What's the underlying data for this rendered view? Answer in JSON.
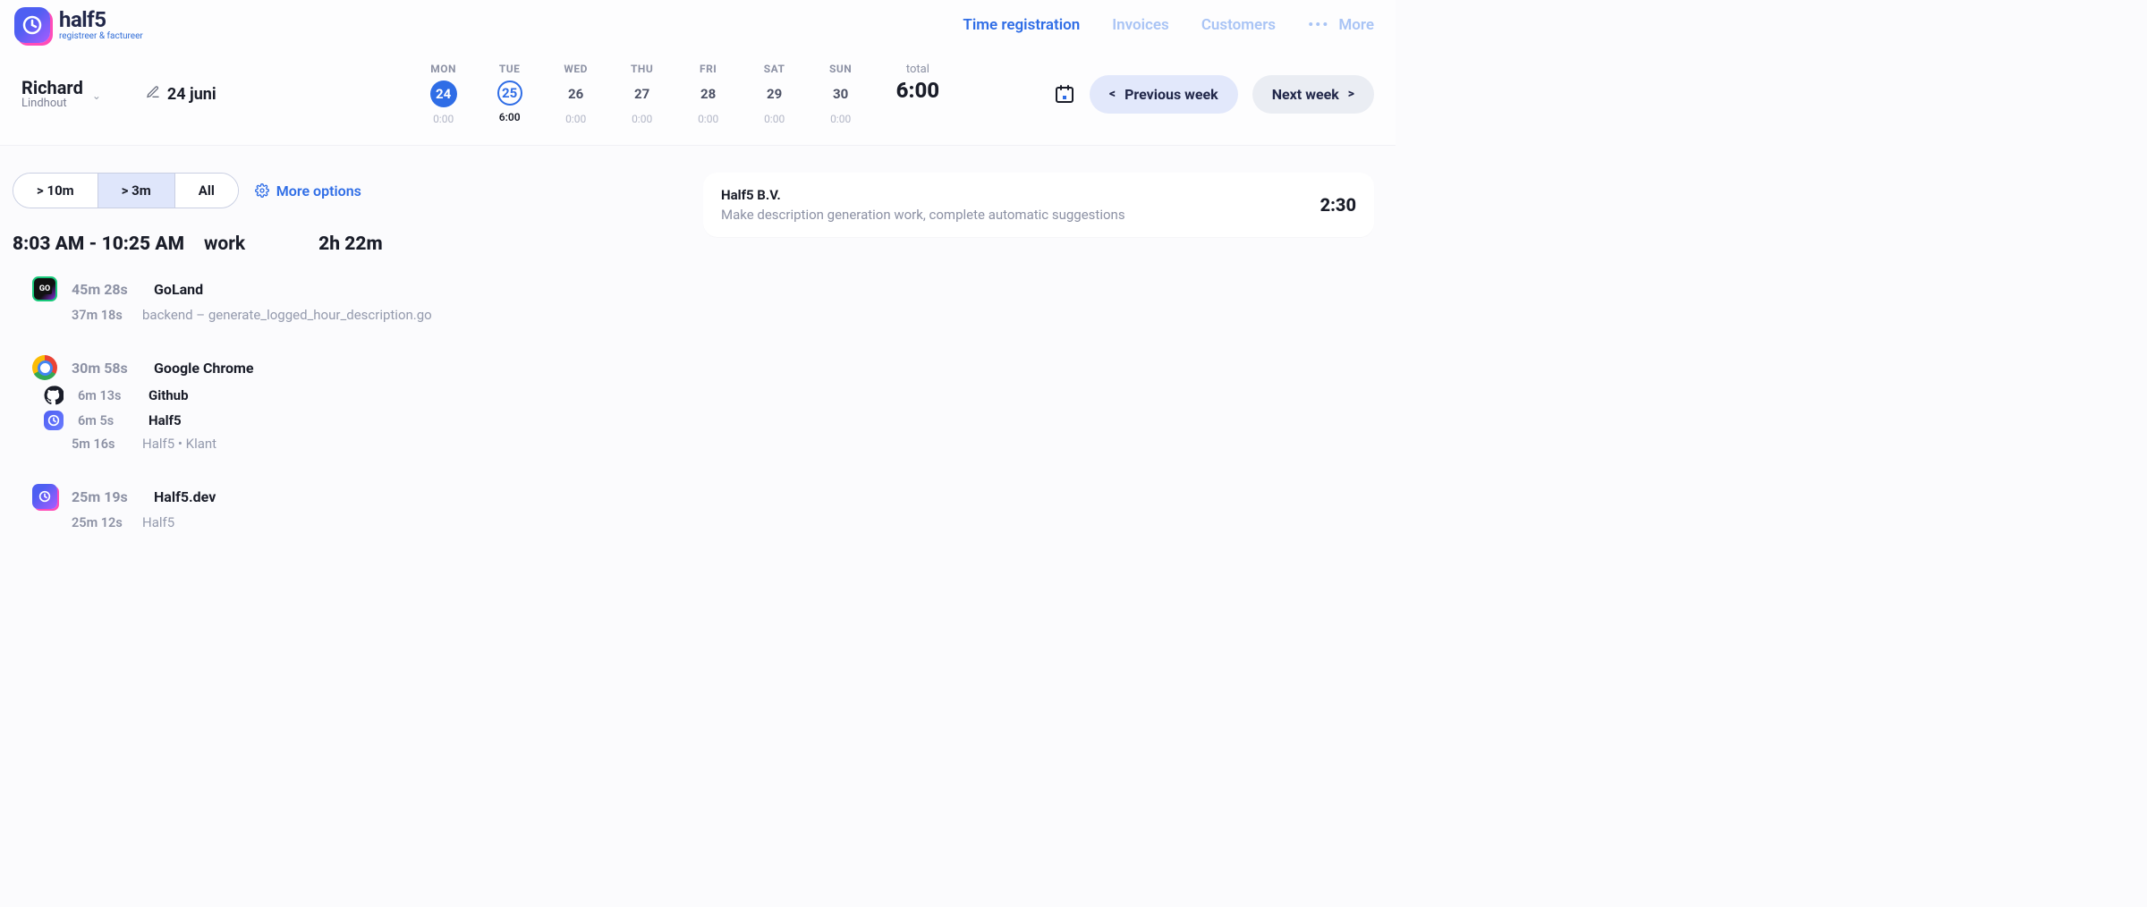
{
  "brand": {
    "name": "half5",
    "subtitle": "registreer & factureer"
  },
  "nav": {
    "time_registration": "Time registration",
    "invoices": "Invoices",
    "customers": "Customers",
    "more": "More"
  },
  "user": {
    "name": "Richard",
    "company": "Lindhout"
  },
  "date_label": "24 juni",
  "week": {
    "days": [
      {
        "dow": "MON",
        "num": "24",
        "time": "0:00",
        "state": "selected"
      },
      {
        "dow": "TUE",
        "num": "25",
        "time": "6:00",
        "state": "today"
      },
      {
        "dow": "WED",
        "num": "26",
        "time": "0:00",
        "state": ""
      },
      {
        "dow": "THU",
        "num": "27",
        "time": "0:00",
        "state": ""
      },
      {
        "dow": "FRI",
        "num": "28",
        "time": "0:00",
        "state": ""
      },
      {
        "dow": "SAT",
        "num": "29",
        "time": "0:00",
        "state": ""
      },
      {
        "dow": "SUN",
        "num": "30",
        "time": "0:00",
        "state": ""
      }
    ],
    "total_label": "total",
    "total_value": "6:00",
    "prev": "Previous week",
    "next": "Next week"
  },
  "filters": {
    "f10m": "> 10m",
    "f3m": "> 3m",
    "fall": "All",
    "more": "More options"
  },
  "session": {
    "range": "8:03 AM - 10:25 AM",
    "label": "work",
    "duration": "2h 22m"
  },
  "apps": {
    "goland": {
      "dur": "45m 28s",
      "name": "GoLand",
      "sub_dur": "37m 18s",
      "sub_txt": "backend – generate_logged_hour_description.go"
    },
    "chrome": {
      "dur": "30m 58s",
      "name": "Google Chrome",
      "gh_dur": "6m 13s",
      "gh_name": "Github",
      "h5_dur": "6m 5s",
      "h5_name": "Half5",
      "h5_sub_dur": "5m 16s",
      "h5_sub_txt": "Half5 • Klant"
    },
    "h5dev": {
      "dur": "25m 19s",
      "name": "Half5.dev",
      "sub_dur": "25m 12s",
      "sub_txt": "Half5"
    }
  },
  "task": {
    "org": "Half5 B.V.",
    "desc": "Make description generation work, complete automatic suggestions",
    "time": "2:30"
  }
}
